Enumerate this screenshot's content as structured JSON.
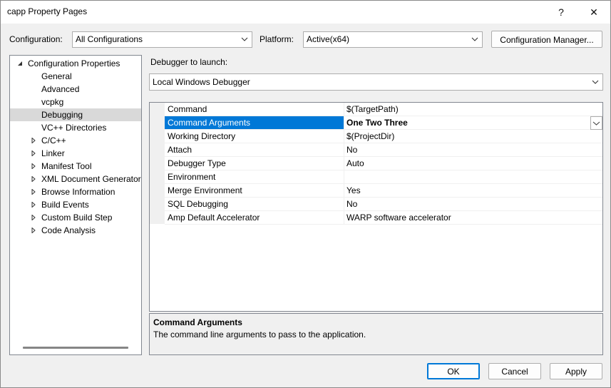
{
  "window": {
    "title": "capp Property Pages",
    "help_glyph": "?",
    "close_glyph": "✕"
  },
  "config": {
    "configuration_label": "Configuration:",
    "configuration_value": "All Configurations",
    "platform_label": "Platform:",
    "platform_value": "Active(x64)",
    "manager_button": "Configuration Manager..."
  },
  "tree": {
    "items": [
      {
        "label": "Configuration Properties",
        "expander": "expanded"
      },
      {
        "label": "General",
        "expander": "none"
      },
      {
        "label": "Advanced",
        "expander": "none"
      },
      {
        "label": "vcpkg",
        "expander": "none"
      },
      {
        "label": "Debugging",
        "expander": "none",
        "selected": true
      },
      {
        "label": "VC++ Directories",
        "expander": "none"
      },
      {
        "label": "C/C++",
        "expander": "collapsed"
      },
      {
        "label": "Linker",
        "expander": "collapsed"
      },
      {
        "label": "Manifest Tool",
        "expander": "collapsed"
      },
      {
        "label": "XML Document Generator",
        "expander": "collapsed"
      },
      {
        "label": "Browse Information",
        "expander": "collapsed"
      },
      {
        "label": "Build Events",
        "expander": "collapsed"
      },
      {
        "label": "Custom Build Step",
        "expander": "collapsed"
      },
      {
        "label": "Code Analysis",
        "expander": "collapsed"
      }
    ]
  },
  "debugger": {
    "label": "Debugger to launch:",
    "value": "Local Windows Debugger"
  },
  "properties": [
    {
      "name": "Command",
      "value": "$(TargetPath)"
    },
    {
      "name": "Command Arguments",
      "value": "One Two Three",
      "selected": true
    },
    {
      "name": "Working Directory",
      "value": "$(ProjectDir)"
    },
    {
      "name": "Attach",
      "value": "No"
    },
    {
      "name": "Debugger Type",
      "value": "Auto"
    },
    {
      "name": "Environment",
      "value": ""
    },
    {
      "name": "Merge Environment",
      "value": "Yes"
    },
    {
      "name": "SQL Debugging",
      "value": "No"
    },
    {
      "name": "Amp Default Accelerator",
      "value": "WARP software accelerator"
    }
  ],
  "description": {
    "title": "Command Arguments",
    "text": "The command line arguments to pass to the application."
  },
  "buttons": {
    "ok": "OK",
    "cancel": "Cancel",
    "apply": "Apply"
  },
  "colors": {
    "selection": "#0078d7",
    "tree_selection": "#d9d9d9"
  }
}
